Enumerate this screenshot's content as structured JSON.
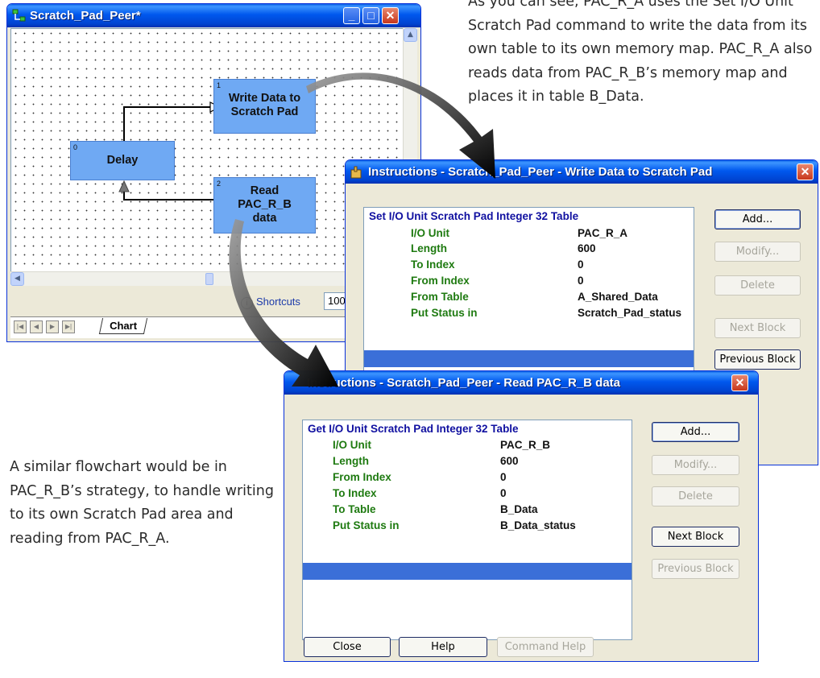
{
  "captions": {
    "top": "As you can see, PAC_R_A uses the Set I/O Unit Scratch Pad command to write the data from its own table to its own memory map. PAC_R_A also reads data from PAC_R_B’s memory map and places it in table B_Data.",
    "left": "A similar flowchart would be in PAC_R_B’s strategy, to handle writing to its own Scratch Pad area and reading from PAC_R_A."
  },
  "chart_window": {
    "title": "Scratch_Pad_Peer*",
    "shortcuts_label": "Shortcuts",
    "zoom_value": "100%",
    "tab_label": "Chart",
    "blocks": [
      {
        "num": "1",
        "label": "Write Data to Scratch Pad"
      },
      {
        "num": "0",
        "label": "Delay"
      },
      {
        "num": "2",
        "label": "Read PAC_R_B data"
      }
    ]
  },
  "dialog_write": {
    "title": "Instructions - Scratch_Pad_Peer - Write Data to Scratch Pad",
    "command": "Set I/O Unit Scratch Pad Integer 32 Table",
    "params": [
      {
        "name": "I/O Unit",
        "value": "PAC_R_A"
      },
      {
        "name": "Length",
        "value": "600"
      },
      {
        "name": "To Index",
        "value": "0"
      },
      {
        "name": "From Index",
        "value": "0"
      },
      {
        "name": "From Table",
        "value": "A_Shared_Data"
      },
      {
        "name": "Put Status in",
        "value": "Scratch_Pad_status"
      }
    ],
    "buttons": {
      "add": "Add...",
      "modify": "Modify...",
      "delete": "Delete",
      "next": "Next Block",
      "previous": "Previous Block"
    }
  },
  "dialog_read": {
    "title": "Instructions - Scratch_Pad_Peer - Read PAC_R_B data",
    "command": "Get I/O Unit Scratch Pad Integer 32 Table",
    "params": [
      {
        "name": "I/O Unit",
        "value": "PAC_R_B"
      },
      {
        "name": "Length",
        "value": "600"
      },
      {
        "name": "From Index",
        "value": "0"
      },
      {
        "name": "To Index",
        "value": "0"
      },
      {
        "name": "To Table",
        "value": "B_Data"
      },
      {
        "name": "Put Status in",
        "value": "B_Data_status"
      }
    ],
    "buttons": {
      "add": "Add...",
      "modify": "Modify...",
      "delete": "Delete",
      "next": "Next Block",
      "previous": "Previous Block",
      "close": "Close",
      "help": "Help",
      "command_help": "Command Help"
    }
  }
}
